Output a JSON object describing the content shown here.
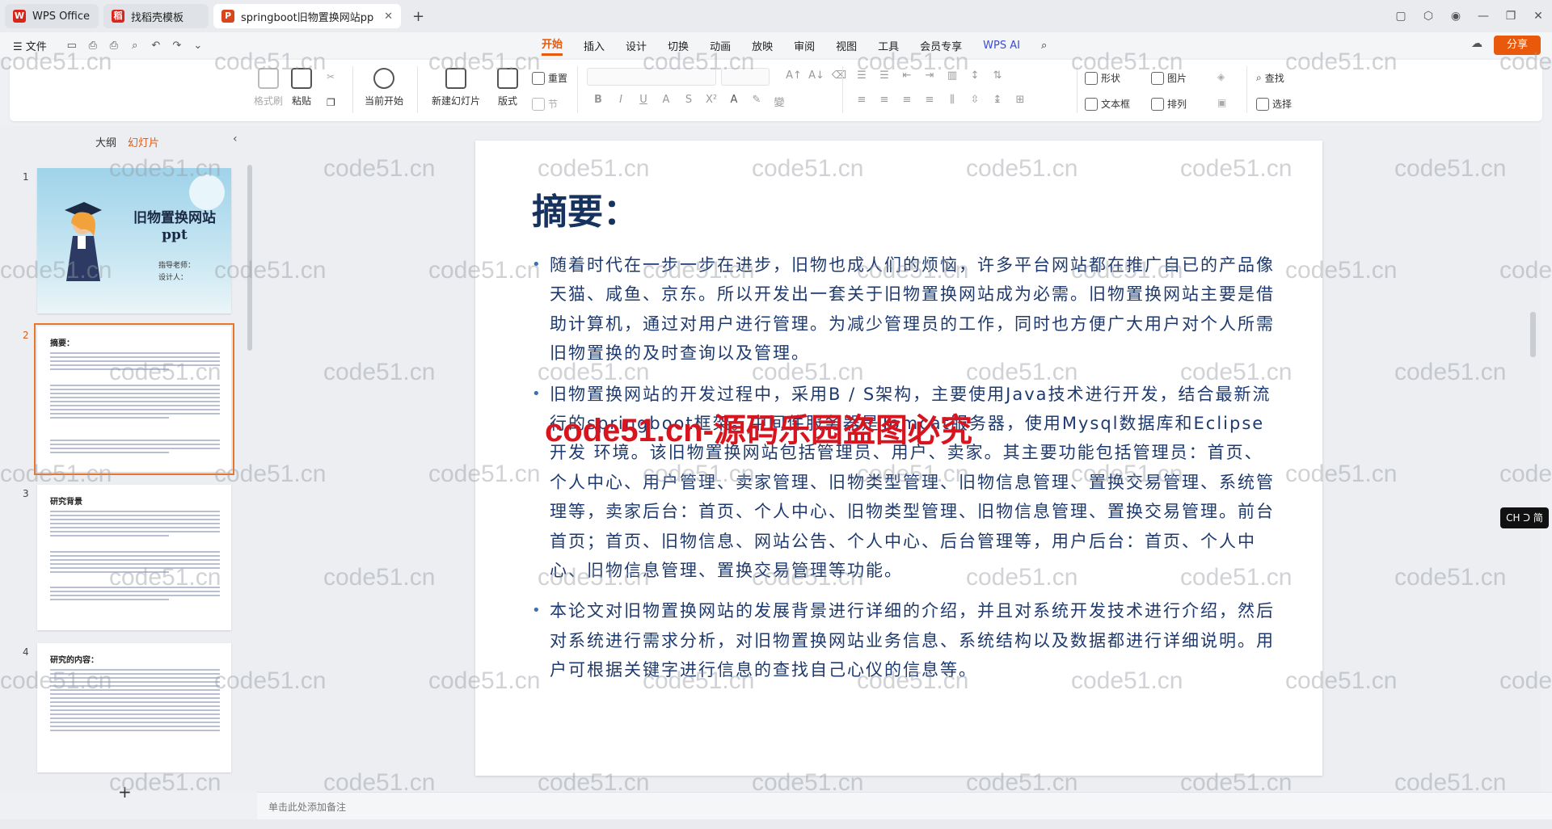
{
  "titlebar": {
    "tabs": [
      {
        "label": "WPS Office"
      },
      {
        "label": "找稻壳模板"
      },
      {
        "label": "springboot旧物置换网站pp"
      }
    ],
    "new_tab": "+"
  },
  "menubar": {
    "file": "☰ 文件",
    "menus": [
      "开始",
      "插入",
      "设计",
      "切换",
      "动画",
      "放映",
      "审阅",
      "视图",
      "工具",
      "会员专享",
      "WPS AI"
    ],
    "active": "开始",
    "share": "分享"
  },
  "ribbon": {
    "format_painter": "格式刷",
    "paste": "粘贴",
    "play_from_current": "当前开始",
    "new_slide": "新建幻灯片",
    "layout": "版式",
    "reset": "重置",
    "section": "节",
    "shape": "形状",
    "picture": "图片",
    "textbox": "文本框",
    "arrange": "排列",
    "find": "查找",
    "select": "选择"
  },
  "leftpane": {
    "tab_outline": "大纲",
    "tab_slides": "幻灯片",
    "slides": [
      {
        "num": "1",
        "title": "旧物置换网站\nppt",
        "sub1": "指导老师：",
        "sub2": "设计人："
      },
      {
        "num": "2",
        "title": "摘要："
      },
      {
        "num": "3",
        "title": "研究背景"
      },
      {
        "num": "4",
        "title": "研究的内容："
      }
    ],
    "add": "+"
  },
  "slide": {
    "title": "摘要：",
    "bullets": [
      "随着时代在一步一步在进步，旧物也成人们的烦恼，许多平台网站都在推广自已的产品像天猫、咸鱼、京东。所以开发出一套关于旧物置换网站成为必需。旧物置换网站主要是借助计算机，通过对用户进行管理。为减少管理员的工作，同时也方便广大用户对个人所需旧物置换的及时查询以及管理。",
      "旧物置换网站的开发过程中，采用B / S架构，主要使用Java技术进行开发，结合最新流行的springboot框架。中间件服务器是Tomcat服务器，使用Mysql数据库和Eclipse开发 环境。该旧物置换网站包括管理员、用户、卖家。其主要功能包括管理员：首页、个人中心、用户管理、卖家管理、旧物类型管理、旧物信息管理、置换交易管理、系统管理等，卖家后台：首页、个人中心、旧物类型管理、旧物信息管理、置换交易管理。前台首页；首页、旧物信息、网站公告、个人中心、后台管理等，用户后台：首页、个人中心、旧物信息管理、置换交易管理等功能。",
      "本论文对旧物置换网站的发展背景进行详细的介绍，并且对系统开发技术进行介绍，然后对系统进行需求分析，对旧物置换网站业务信息、系统结构以及数据都进行详细说明。用户可根据关键字进行信息的查找自己心仪的信息等。"
    ]
  },
  "notes_placeholder": "单击此处添加备注",
  "ime": "CH ᑐ 简",
  "watermark": {
    "text": "code51.cn",
    "banner": "code51.cn-源码乐园盗图必究"
  },
  "colors": {
    "accent": "#e8590c",
    "slide_text": "#1e3a6e",
    "slide_title": "#16325f",
    "banner": "#d8141f"
  }
}
